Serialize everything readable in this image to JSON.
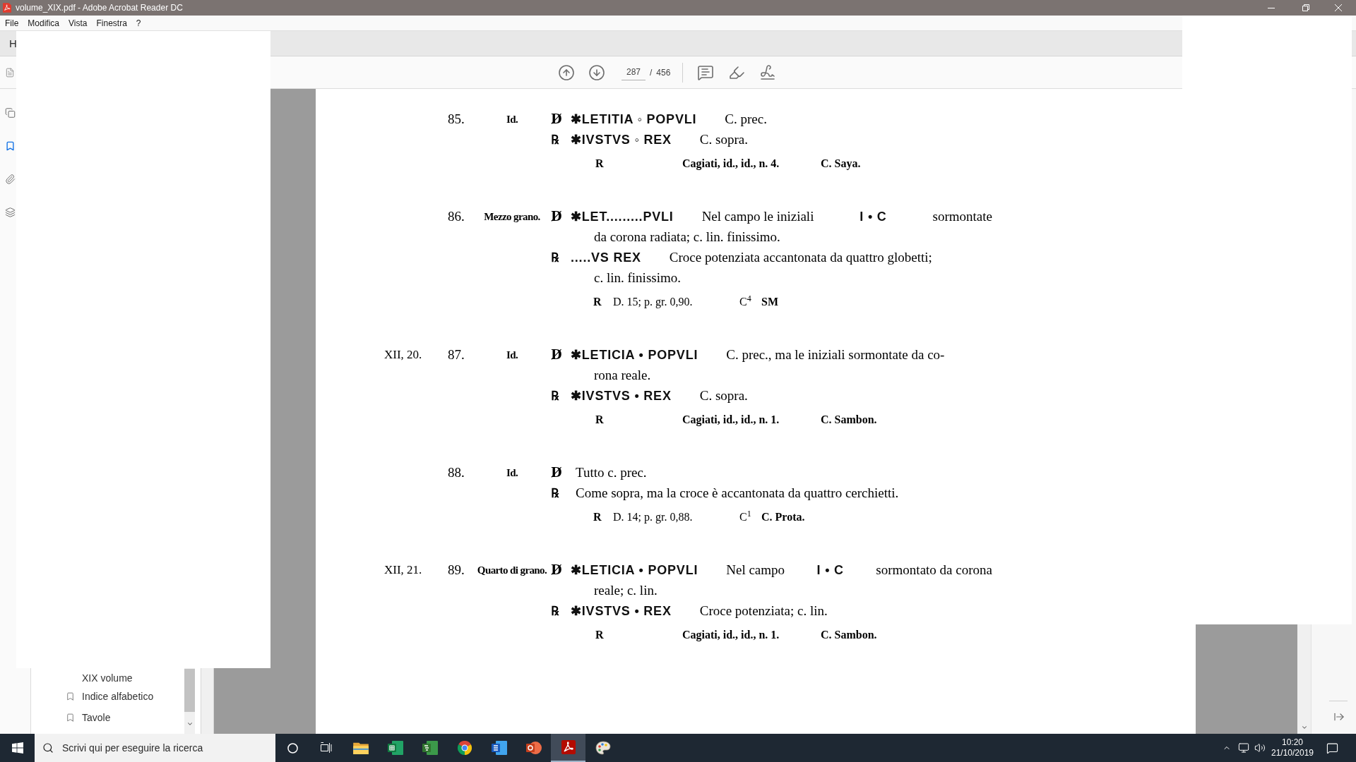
{
  "window": {
    "title": "volume_XIX.pdf - Adobe Acrobat Reader DC"
  },
  "menu": [
    "File",
    "Modifica",
    "Vista",
    "Finestra",
    "?"
  ],
  "tabs": [
    {
      "label": "H"
    }
  ],
  "toolbar": {
    "page": "287",
    "separator": "/",
    "page_count": "456"
  },
  "left_rail": [
    {
      "kind": "pages",
      "selected": false
    },
    {
      "kind": "bookmarks",
      "selected": true
    },
    {
      "kind": "attachments",
      "selected": false
    },
    {
      "kind": "layers",
      "selected": false
    }
  ],
  "bookmarks": [
    {
      "kind": "continuation",
      "label": "XIX volume"
    },
    {
      "kind": "bookmark",
      "label": "Indice alfabetico"
    },
    {
      "kind": "bookmark",
      "label": "Tavole"
    }
  ],
  "document": {
    "entries": [
      {
        "number": "85.",
        "name": "Id.",
        "lines": [
          {
            "kind": "face",
            "symbol": "D̸",
            "legend": "✱LETITIA ◦ POPVLI",
            "description": [
              {
                "kind": "text",
                "text": "C. prec."
              }
            ]
          },
          {
            "kind": "face",
            "symbol": "℞",
            "legend": "✱IVSTVS ◦ REX",
            "description": [
              {
                "kind": "text",
                "text": "C. sopra."
              }
            ]
          },
          {
            "kind": "source",
            "mark": "R",
            "source": "Cagiati, id., id., n. 4.",
            "collection": "C. Saya."
          }
        ]
      },
      {
        "number": "86.",
        "name": "Mezzo grano.",
        "lines": [
          {
            "kind": "face",
            "symbol": "D̸",
            "legend": "✱LET.........PVLI",
            "description": [
              {
                "kind": "text",
                "text": "Nel campo le iniziali"
              },
              {
                "kind": "legend",
                "text": "I • C"
              },
              {
                "kind": "text",
                "text": "sormontate"
              }
            ]
          },
          {
            "kind": "continuation",
            "text": "da corona radiata; c. lin. finissimo."
          },
          {
            "kind": "face",
            "symbol": "℞",
            "legend": ".....VS REX",
            "description": [
              {
                "kind": "text",
                "text": "Croce potenziata accantonata da quattro globetti;"
              }
            ]
          },
          {
            "kind": "continuation",
            "text": "c. lin. finissimo."
          },
          {
            "kind": "measure",
            "mark": "R",
            "measure": "D. 15; p. gr. 0,90.",
            "grade": "C$^{4}$",
            "collection": "SM"
          }
        ]
      },
      {
        "ref": "XII, 20.",
        "number": "87.",
        "name": "Id.",
        "lines": [
          {
            "kind": "face",
            "symbol": "D̸",
            "legend": "✱LETICIA • POPVLI",
            "description": [
              {
                "kind": "text",
                "text": "C. prec., ma le iniziali sormontate da co-"
              }
            ]
          },
          {
            "kind": "continuation",
            "text": "rona reale."
          },
          {
            "kind": "face",
            "symbol": "℞",
            "legend": "✱IVSTVS • REX",
            "description": [
              {
                "kind": "text",
                "text": "C. sopra."
              }
            ]
          },
          {
            "kind": "source",
            "mark": "R",
            "source": "Cagiati, id., id., n. 1.",
            "collection": "C. Sambon."
          }
        ]
      },
      {
        "number": "88.",
        "name": "Id.",
        "lines": [
          {
            "kind": "face",
            "symbol": "D̸",
            "description": [
              {
                "kind": "text",
                "text": "Tutto c. prec."
              }
            ]
          },
          {
            "kind": "face",
            "symbol": "℞",
            "description": [
              {
                "kind": "text",
                "text": "Come sopra, ma la croce è accantonata da quattro cerchietti."
              }
            ]
          },
          {
            "kind": "measure",
            "mark": "R",
            "measure": "D. 14; p. gr. 0,88.",
            "grade": "C$^{1}$",
            "collection": "C. Prota."
          }
        ]
      },
      {
        "ref": "XII, 21.",
        "number": "89.",
        "name": "Quarto di grano.",
        "lines": [
          {
            "kind": "face",
            "symbol": "D̸",
            "legend": "✱LETICIA • POPVLI",
            "description": [
              {
                "kind": "text",
                "text": "Nel campo"
              },
              {
                "kind": "legend",
                "text": "I • C"
              },
              {
                "kind": "text",
                "text": "sormontato da corona"
              }
            ]
          },
          {
            "kind": "continuation",
            "text": "reale; c. lin."
          },
          {
            "kind": "face",
            "symbol": "℞",
            "legend": "✱IVSTVS • REX",
            "description": [
              {
                "kind": "text",
                "text": "Croce potenziata; c. lin."
              }
            ]
          },
          {
            "kind": "source",
            "mark": "R",
            "source": "Cagiati, id., id., n. 1.",
            "collection": "C. Sambon."
          }
        ]
      }
    ]
  },
  "taskbar": {
    "search": {
      "placeholder": "Scrivi qui per eseguire la ricerca"
    },
    "apps": [
      {
        "kind": "file-explorer",
        "selected": false
      },
      {
        "kind": "excel",
        "selected": false
      },
      {
        "kind": "project",
        "selected": false
      },
      {
        "kind": "chrome",
        "selected": false
      },
      {
        "kind": "word",
        "selected": false
      },
      {
        "kind": "powerpoint",
        "selected": false
      },
      {
        "kind": "acrobat",
        "selected": true
      },
      {
        "kind": "paint",
        "selected": false
      }
    ],
    "clock": {
      "time": "10:20",
      "date": "21/10/2019"
    }
  }
}
